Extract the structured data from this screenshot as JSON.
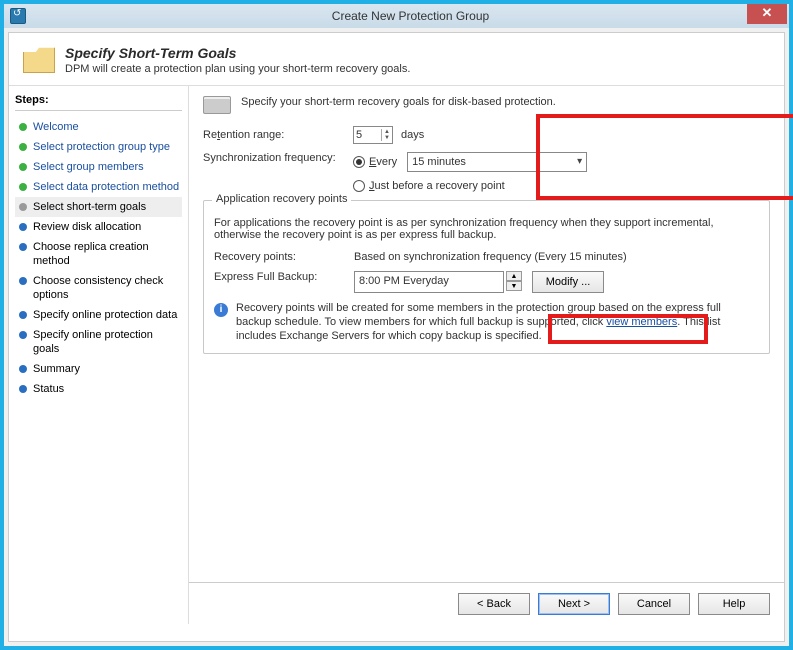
{
  "window": {
    "title": "Create New Protection Group",
    "close": "✕"
  },
  "header": {
    "title": "Specify Short-Term Goals",
    "subtitle": "DPM will create a protection plan using your short-term recovery goals."
  },
  "steps": {
    "heading": "Steps:",
    "items": [
      {
        "label": "Welcome",
        "state": "done",
        "link": true
      },
      {
        "label": "Select protection group type",
        "state": "done",
        "link": true
      },
      {
        "label": "Select group members",
        "state": "done",
        "link": true
      },
      {
        "label": "Select data protection method",
        "state": "done",
        "link": true
      },
      {
        "label": "Select short-term goals",
        "state": "current",
        "link": false
      },
      {
        "label": "Review disk allocation",
        "state": "pending",
        "link": false
      },
      {
        "label": "Choose replica creation method",
        "state": "pending",
        "link": false
      },
      {
        "label": "Choose consistency check options",
        "state": "pending",
        "link": false
      },
      {
        "label": "Specify online protection data",
        "state": "pending",
        "link": false
      },
      {
        "label": "Specify online protection goals",
        "state": "pending",
        "link": false
      },
      {
        "label": "Summary",
        "state": "pending",
        "link": false
      },
      {
        "label": "Status",
        "state": "pending",
        "link": false
      }
    ]
  },
  "main": {
    "intro": "Specify your short-term recovery goals for disk-based protection.",
    "retention_label_pre": "Re",
    "retention_label_u": "t",
    "retention_label_post": "ention range:",
    "retention_value": "5",
    "retention_unit": "days",
    "sync_label": "Synchronization frequency:",
    "sync_every_u": "E",
    "sync_every_post": "very",
    "sync_every_value": "15 minutes",
    "sync_just_u": "J",
    "sync_just_post": "ust before a recovery point",
    "group_legend": "Application recovery points",
    "group_desc": "For applications the recovery point is as per synchronization frequency when they support incremental, otherwise the recovery point is as per express full backup.",
    "recovery_points_label": "Recovery points:",
    "recovery_points_value": "Based on synchronization frequency (Every 15 minutes)",
    "express_label": "Express Full Backup:",
    "express_value": "8:00 PM Everyday",
    "modify_btn": "Modify ...",
    "info_text_1": "Recovery points will be created for some members in the protection group based on the express full backup schedule. To view members for which full backup is supported, click ",
    "info_link": "view members",
    "info_text_2": ". This list includes Exchange Servers for which copy backup is specified."
  },
  "buttons": {
    "back": "< Back",
    "next": "Next >",
    "cancel": "Cancel",
    "help": "Help"
  }
}
